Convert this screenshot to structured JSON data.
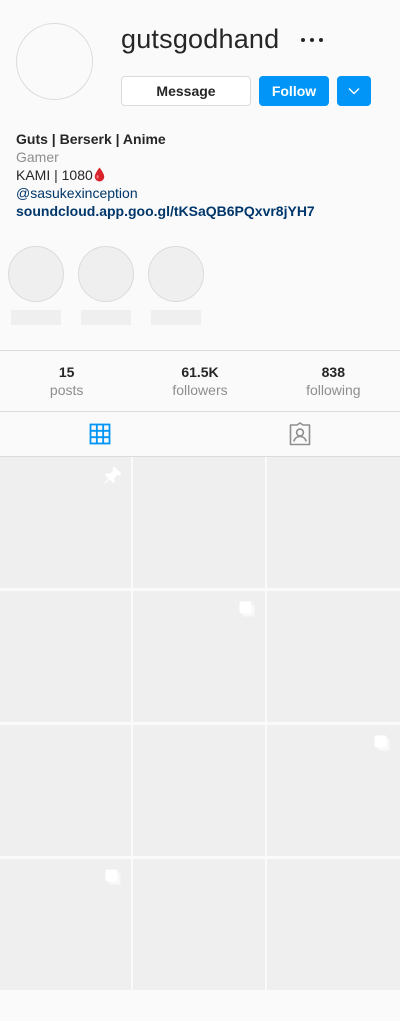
{
  "profile": {
    "username": "gutsgodhand",
    "message_label": "Message",
    "follow_label": "Follow"
  },
  "bio": {
    "name": "Guts | Berserk | Anime",
    "category": "Gamer",
    "line": "KAMI | 1080",
    "mention": "@sasukexinception",
    "link": "soundcloud.app.goo.gl/tKSaQB6PQxvr8jYH7"
  },
  "stats": {
    "posts": {
      "value": "15",
      "label": "posts"
    },
    "followers": {
      "value": "61.5K",
      "label": "followers"
    },
    "following": {
      "value": "838",
      "label": "following"
    }
  },
  "tabs": [
    {
      "icon": "grid-icon",
      "active": true
    },
    {
      "icon": "tagged-icon",
      "active": false
    }
  ],
  "posts": [
    {
      "badge": "pin-icon"
    },
    {
      "badge": ""
    },
    {
      "badge": ""
    },
    {
      "badge": ""
    },
    {
      "badge": "carousel-icon"
    },
    {
      "badge": ""
    },
    {
      "badge": ""
    },
    {
      "badge": ""
    },
    {
      "badge": "carousel-icon"
    },
    {
      "badge": "carousel-icon"
    },
    {
      "badge": ""
    },
    {
      "badge": ""
    }
  ],
  "colors": {
    "accent": "#0095f6",
    "link": "#00376b",
    "muted": "#8e8e8e",
    "placeholder": "#efefef",
    "active_tab": "#0095f6"
  }
}
